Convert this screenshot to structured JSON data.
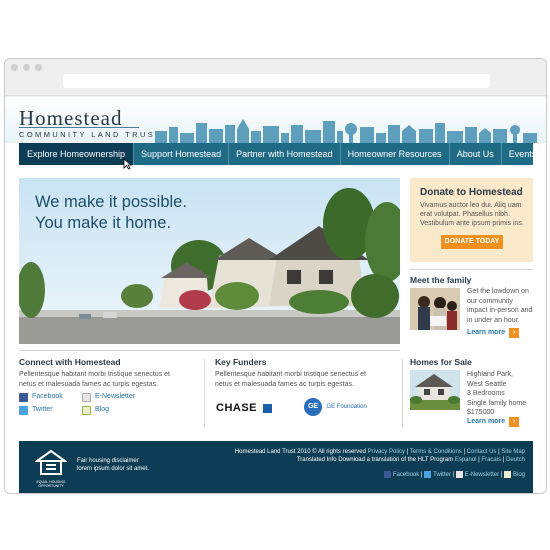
{
  "logo": {
    "name": "Homestead",
    "tagline": "COMMUNITY LAND TRUST"
  },
  "nav": {
    "items": [
      {
        "label": "Explore Homeownership",
        "active": true
      },
      {
        "label": "Support Homestead",
        "active": false
      },
      {
        "label": "Partner with Homestead",
        "active": false
      },
      {
        "label": "Homeowner Resources",
        "active": false
      },
      {
        "label": "About Us",
        "active": false
      },
      {
        "label": "Events",
        "active": false
      }
    ]
  },
  "hero": {
    "line1": "We make it possible.",
    "line2": "You make it home."
  },
  "donate": {
    "title": "Donate to Homestead",
    "body": "Vivamus auctor leo dui. Aliq uam erat volutpat. Phasellus nibh. Vestibulum ante ipsum primis ins.",
    "button": "DONATE TODAY"
  },
  "family": {
    "title": "Meet the family",
    "body": "Get the lowdown on our community impact in-person and in under an hour.",
    "more": "Learn more"
  },
  "connect": {
    "title": "Connect with Homestead",
    "body": "Pellentesque habitant morbi tristique senectus et netus et malesuada fames ac turpis egestas.",
    "facebook": "Facebook",
    "twitter": "Twitter",
    "enewsletter": "E-Newsletter",
    "blog": "Blog"
  },
  "funders": {
    "title": "Key Funders",
    "body": "Pellentesque habitant morbi tristique senectus et netus et malesuada fames ac turpis egestas.",
    "chase": "CHASE",
    "ge_mark": "GE",
    "ge_name": "GE Foundation"
  },
  "homes": {
    "title": "Homes for Sale",
    "lines": [
      "Highland Park,",
      "West Seattle",
      "3 Bedrooms",
      "Single family home",
      "$175000"
    ],
    "more": "Learn more"
  },
  "footer": {
    "fh_line1": "Fair housing disclaimer",
    "fh_line2": "lorem ipsum dolor sit amet.",
    "eho": "EQUAL HOUSING OPPORTUNITY",
    "copyright": "Homestead Land Trust 2010 © All rights reserved",
    "privacy": "Privacy Policy",
    "terms": "Terms & Conditions",
    "contact": "Contact Us",
    "sitemap": "Site Map",
    "translated": "Translated Info Download a translation of the HLT Program",
    "espanol": "Espanol",
    "fracais": "Fracais",
    "deutch": "Deutch",
    "facebook": "Facebook",
    "twitter": "Twitter",
    "enewsletter": "E-Newsletter",
    "blog": "Blog",
    "sep": "|"
  },
  "colors": {
    "nav": "#1f6b86",
    "nav_active": "#0d3c55",
    "accent": "#f0901f",
    "footer": "#0d3c55"
  }
}
